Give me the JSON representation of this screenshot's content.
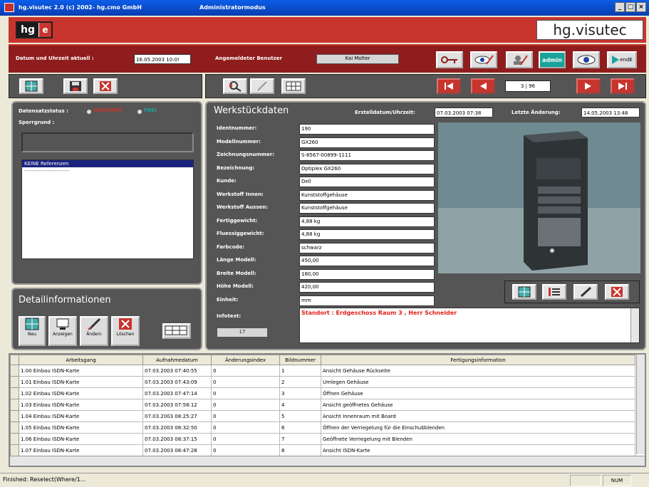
{
  "window": {
    "title": "hg.visutec 2.0 (c) 2002- hg.cmo GmbH",
    "mode": "Administratormodus"
  },
  "brand": {
    "logo_left": "hg",
    "logo_right": "e",
    "name": "hg.visutec"
  },
  "header": {
    "datetime_label": "Datum und Uhrzeit aktuell :",
    "datetime_value": "16.05.2003 10:0!",
    "user_label": "Angemeldeter Benutzer",
    "user_value": "Kai Molter",
    "admin_label": "admin",
    "end_label": "endE"
  },
  "nav": {
    "record": "3 | 96"
  },
  "status": {
    "locked_label": "Datensatzstatus :",
    "locked": "GESPERRT",
    "free": "FREI",
    "reason_label": "Sperrgrund :",
    "refs_header": "KEINE Referenzen",
    "refs_line": "-------------------------"
  },
  "detail": {
    "title": "Detailinformationen",
    "buttons": [
      "Neu",
      "Anzeigen",
      "Ändern",
      "Löschen"
    ],
    "count": "17"
  },
  "workpiece": {
    "title": "Werkstückdaten",
    "created_label": "Erstelldatum/Uhrzeit:",
    "created": "07.03.2003 07:38",
    "changed_label": "Letzte Änderung:",
    "changed": "14.05.2003 13:48",
    "fields": [
      {
        "label": "Identnummer:",
        "value": "190"
      },
      {
        "label": "Modellnummer:",
        "value": "GX260"
      },
      {
        "label": "Zeichnungsnummer:",
        "value": "S-8567-00899-1111"
      },
      {
        "label": "Bezeichnung:",
        "value": "Optiplex GX260"
      },
      {
        "label": "Kunde:",
        "value": "Dell"
      },
      {
        "label": "Werkstoff Innen:",
        "value": "Kunststoffgehäuse"
      },
      {
        "label": "Werkstoff Aussen:",
        "value": "Kunststoffgehäuse"
      },
      {
        "label": "Fertiggewicht:",
        "value": "4,88 kg"
      },
      {
        "label": "Fluessiggewicht:",
        "value": "4,88 kg"
      },
      {
        "label": "Farbcode:",
        "value": "schwarz"
      },
      {
        "label": "Länge Modell:",
        "value": "450,00"
      },
      {
        "label": "Breite Modell:",
        "value": "180,00"
      },
      {
        "label": "Höhe Modell:",
        "value": "420,00"
      },
      {
        "label": "Einheit:",
        "value": "mm"
      }
    ],
    "info_label": "Infotext:",
    "info_text": "Standort : Erdgeschoss Raum 3 , Herr Schneider"
  },
  "table": {
    "headers": [
      "Arbeitsgang",
      "Aufnahmedatum",
      "Änderungsindex",
      "Bildnummer",
      "Fertigungsinformation"
    ],
    "rows": [
      [
        "1.00 Einbau ISDN-Karte",
        "07.03.2003 07:40:55",
        "0",
        "1",
        "Ansicht Gehäuse Rückseite"
      ],
      [
        "1.01 Einbau ISDN-Karte",
        "07.03.2003 07:43:09",
        "0",
        "2",
        "Umlegen Gehäuse"
      ],
      [
        "1.02 Einbau ISDN-Karte",
        "07.03.2003 07:47:14",
        "0",
        "3",
        "Öffnen Gehäuse"
      ],
      [
        "1.03 Einbau ISDN-Karte",
        "07.03.2003 07:58:12",
        "0",
        "4",
        "Ansicht geöffnetes Gehäuse"
      ],
      [
        "1.04 Einbau ISDN-Karte",
        "07.03.2003 08:25:27",
        "0",
        "5",
        "Ansicht Innenraum mit Board"
      ],
      [
        "1.05 Einbau ISDN-Karte",
        "07.03.2003 08:32:50",
        "0",
        "6",
        "Öffnen der Verriegelung für die Einschubblenden"
      ],
      [
        "1.06 Einbau ISDN-Karte",
        "07.03.2003 08:37:15",
        "0",
        "7",
        "Geöffnete Verriegelung mit Blenden"
      ],
      [
        "1.07 Einbau ISDN-Karte",
        "07.03.2003 08:47:28",
        "0",
        "8",
        "Ansicht ISDN-Karte"
      ]
    ]
  },
  "statusbar": {
    "text": "Finished: Reselect(Where/1...",
    "num": "NUM"
  }
}
